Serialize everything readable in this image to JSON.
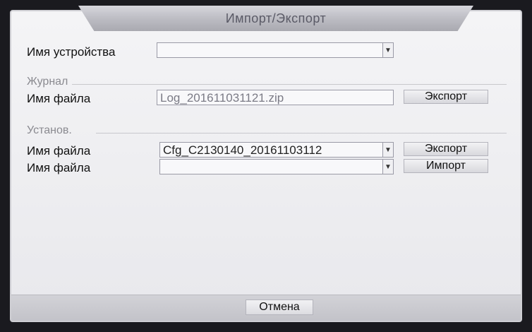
{
  "dialog": {
    "title": "Импорт/Экспорт"
  },
  "device": {
    "label": "Имя устройства",
    "value": ""
  },
  "journal": {
    "section_title": "Журнал",
    "file_label": "Имя файла",
    "file_value": "Log_201611031121.zip",
    "export_label": "Экспорт"
  },
  "settings": {
    "section_title": "Установ.",
    "export_file_label": "Имя файла",
    "export_file_value": "Cfg_C2130140_20161103112",
    "export_label": "Экспорт",
    "import_file_label": "Имя файла",
    "import_file_value": "",
    "import_label": "Импорт"
  },
  "footer": {
    "cancel_label": "Отмена"
  },
  "icons": {
    "dropdown": "chevron-down-icon"
  },
  "colors": {
    "dialog_bg": "#f0f0f3",
    "title_tab": "#bdbdc4",
    "section_title": "#8a8a90"
  }
}
